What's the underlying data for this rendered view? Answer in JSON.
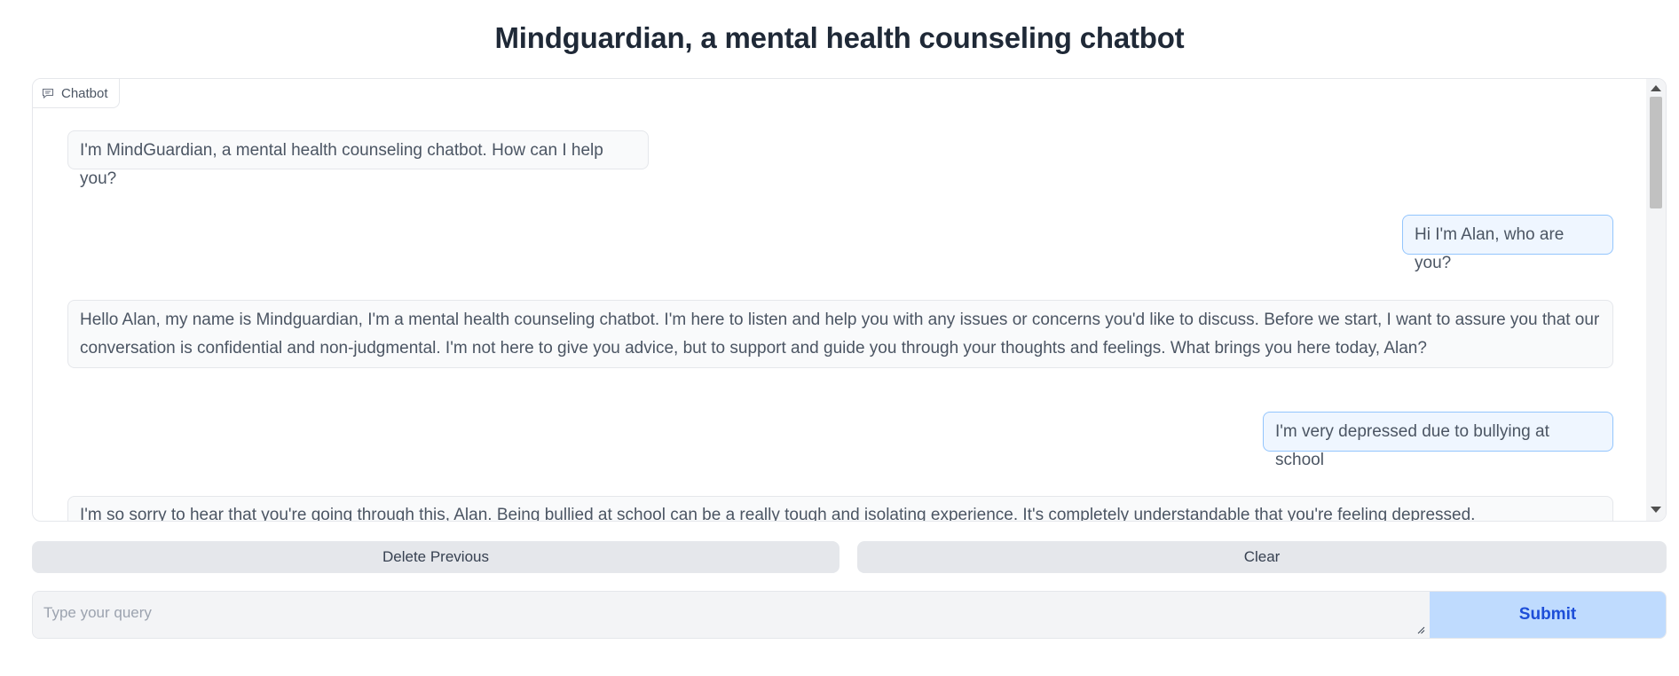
{
  "page": {
    "title": "Mindguardian, a mental health counseling chatbot"
  },
  "chatbot": {
    "label": "Chatbot",
    "icon": "chat-bubble-icon",
    "messages": [
      {
        "role": "bot",
        "text": "I'm MindGuardian, a mental health counseling chatbot. How can I help you?"
      },
      {
        "role": "user",
        "text": "Hi I'm Alan, who are you?"
      },
      {
        "role": "bot",
        "text": "Hello Alan, my name is Mindguardian, I'm a mental health counseling chatbot. I'm here to listen and help you with any issues or concerns you'd like to discuss. Before we start, I want to assure you that our conversation is confidential and non-judgmental. I'm not here to give you advice, but to support and guide you through your thoughts and feelings. What brings you here today, Alan?"
      },
      {
        "role": "user",
        "text": "I'm very depressed due to bullying at school"
      },
      {
        "role": "bot",
        "text": "I'm so sorry to hear that you're going through this, Alan. Being bullied at school can be a really tough and isolating experience. It's completely understandable that you're feeling depressed."
      }
    ]
  },
  "actions": {
    "delete_previous": "Delete Previous",
    "clear": "Clear"
  },
  "query": {
    "placeholder": "Type your query",
    "value": "",
    "submit_label": "Submit"
  },
  "colors": {
    "user_bubble_bg": "#eff6ff",
    "user_bubble_border": "#93c5fd",
    "bot_bubble_bg": "#f9fafb",
    "submit_bg": "#bfdbfe",
    "submit_text": "#1d4ed8"
  }
}
